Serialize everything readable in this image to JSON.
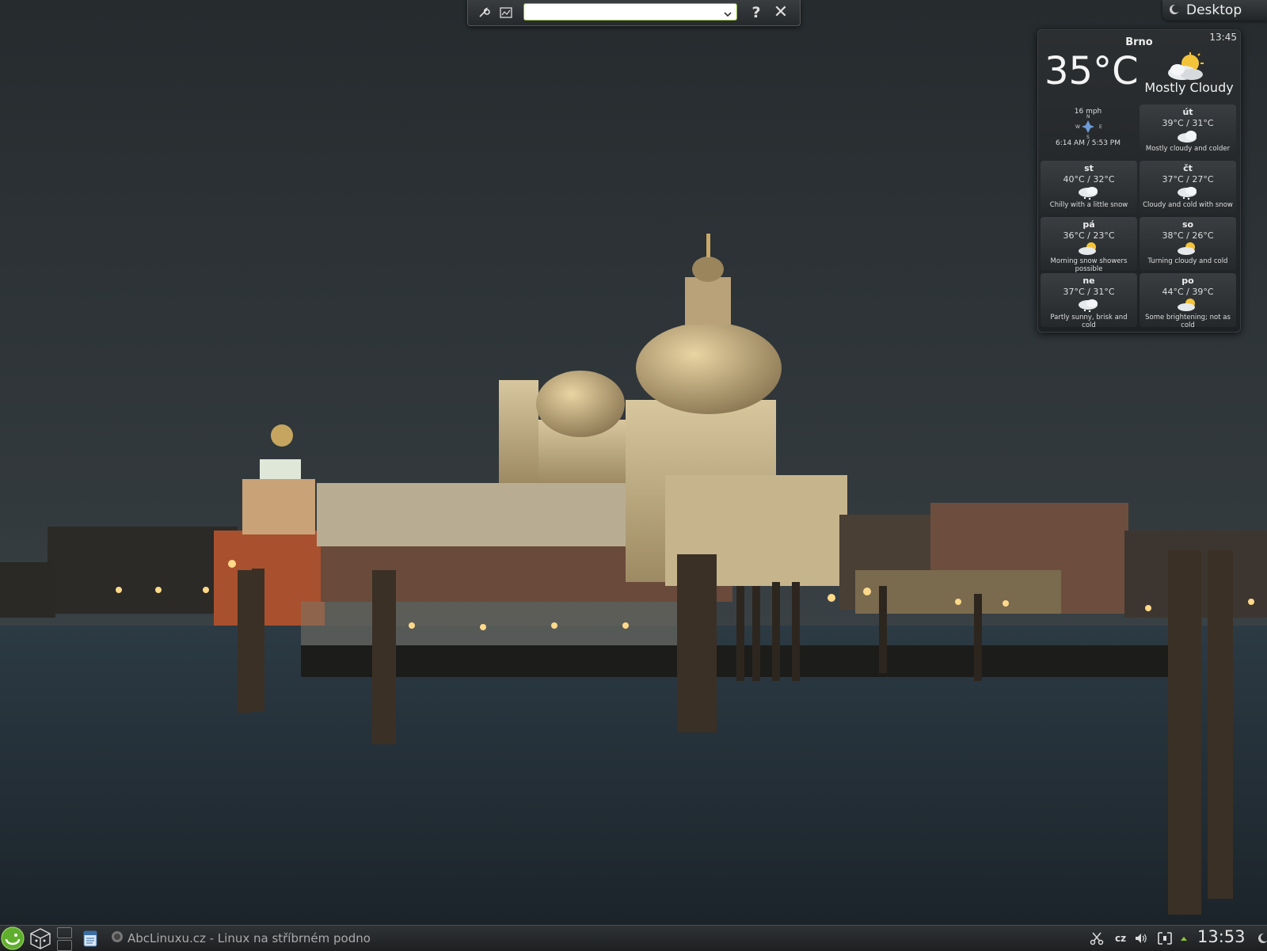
{
  "krunner": {
    "search_value": "",
    "help_label": "?",
    "close_label": "✕"
  },
  "toolbox": {
    "label": "Desktop"
  },
  "weather": {
    "city": "Brno",
    "time": "13:45",
    "temperature": "35°C",
    "condition": "Mostly Cloudy",
    "wind_speed": "16 mph",
    "compass": {
      "n": "N",
      "w": "W",
      "e": "E",
      "s": "S"
    },
    "sunrise_sunset": "6:14 AM / 5:53 PM",
    "forecast": [
      {
        "day": "út",
        "range": "39°C / 31°C",
        "icon": "cloudy-icon",
        "desc": "Mostly cloudy and colder"
      },
      {
        "day": "st",
        "range": "40°C / 32°C",
        "icon": "snow-cloud-icon",
        "desc": "Chilly with a little snow"
      },
      {
        "day": "čt",
        "range": "37°C / 27°C",
        "icon": "snow-cloud-icon",
        "desc": "Cloudy and cold with snow"
      },
      {
        "day": "pá",
        "range": "36°C / 23°C",
        "icon": "sun-snow-icon",
        "desc": "Morning snow showers possible"
      },
      {
        "day": "so",
        "range": "38°C / 26°C",
        "icon": "partly-cloudy-icon",
        "desc": "Turning cloudy and cold"
      },
      {
        "day": "ne",
        "range": "37°C / 31°C",
        "icon": "snow-cloud-icon",
        "desc": "Partly sunny, brisk and cold"
      },
      {
        "day": "po",
        "range": "44°C / 39°C",
        "icon": "partly-cloudy-icon",
        "desc": "Some brightening; not as cold"
      }
    ]
  },
  "taskbar": {
    "task_title": "AbcLinuxu.cz - Linux na stříbrném podno",
    "keyboard_layout": "cz",
    "clock": "13:53"
  }
}
